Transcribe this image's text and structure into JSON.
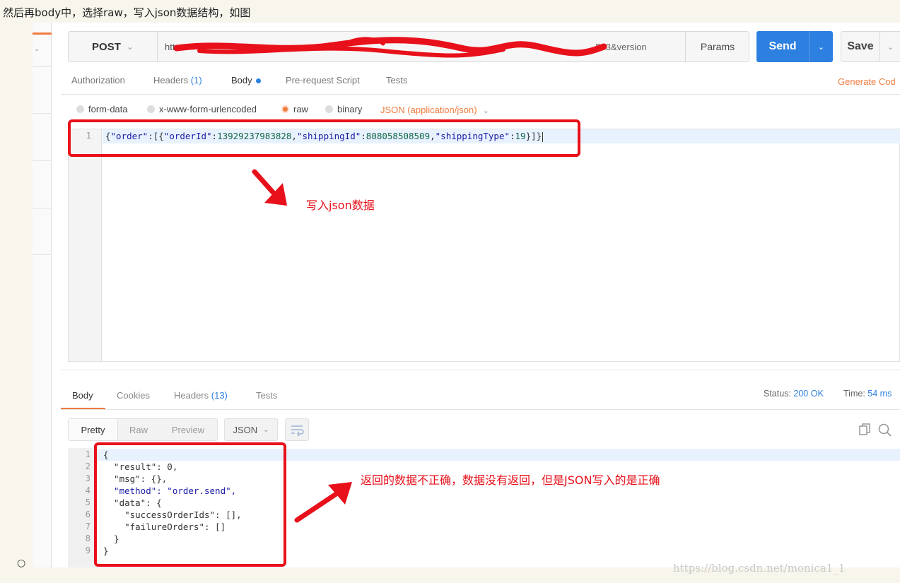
{
  "caption": "然后再body中，选择raw，写入json数据结构，如图",
  "request": {
    "method": "POST",
    "url_prefix": "htt",
    "url_tail": "...503&version",
    "params_label": "Params",
    "send_label": "Send",
    "save_label": "Save"
  },
  "request_tabs": {
    "authorization": "Authorization",
    "headers": "Headers",
    "headers_count": "(1)",
    "body": "Body",
    "prerequest": "Pre-request Script",
    "tests": "Tests",
    "generate_code": "Generate Cod"
  },
  "body_types": {
    "form_data": "form-data",
    "urlencoded": "x-www-form-urlencoded",
    "raw": "raw",
    "binary": "binary",
    "content_type": "JSON (application/json)"
  },
  "request_body": {
    "line_number": "1",
    "tokens": [
      "{",
      "\"order\"",
      ":[{",
      "\"orderId\"",
      ":",
      "13929237983828",
      ",",
      "\"shippingId\"",
      ":",
      "808058508509",
      ",",
      "\"shippingType\"",
      ":",
      "19",
      "}]}"
    ]
  },
  "response_tabs": {
    "body": "Body",
    "cookies": "Cookies",
    "headers": "Headers",
    "headers_count": "(13)",
    "tests": "Tests"
  },
  "response_status": {
    "status_label": "Status:",
    "status_value": "200 OK",
    "time_label": "Time:",
    "time_value": "54 ms"
  },
  "response_view": {
    "pretty": "Pretty",
    "raw": "Raw",
    "preview": "Preview",
    "format": "JSON"
  },
  "response_body": {
    "line_numbers": [
      "1",
      "2",
      "3",
      "4",
      "5",
      "6",
      "7",
      "8",
      "9"
    ],
    "lines": [
      "{",
      "  \"result\": 0,",
      "  \"msg\": {},",
      "  \"method\": \"order.send\",",
      "  \"data\": {",
      "    \"successOrderIds\": [],",
      "    \"failureOrders\": []",
      "  }",
      "}"
    ]
  },
  "annotations": {
    "note1": "写入json数据",
    "note2": "返回的数据不正确，数据没有返回，但是JSON写入的是正确"
  },
  "bullet": "○",
  "watermark": "https://blog.csdn.net/monica1_1",
  "colors": {
    "accent_orange": "#f07c3e",
    "send_blue": "#2d7fe0",
    "annotation_red": "#e8101a"
  }
}
